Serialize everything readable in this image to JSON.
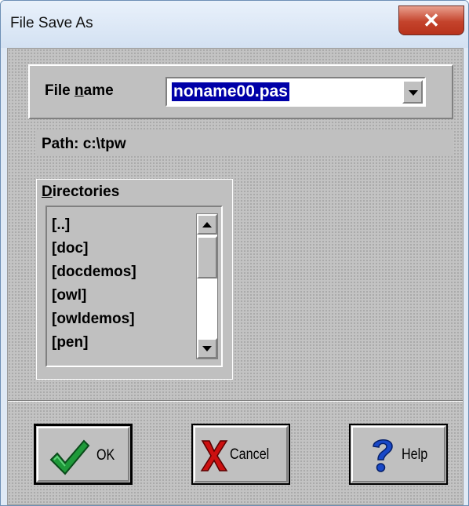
{
  "window": {
    "title": "File Save As",
    "close_glyph": "✕"
  },
  "file_name": {
    "label_pre": "File ",
    "label_key": "n",
    "label_post": "ame",
    "value": "noname00.pas"
  },
  "path": {
    "text": "Path: c:\\tpw"
  },
  "directories": {
    "label_key": "D",
    "label_rest": "irectories",
    "items": [
      "[..]",
      "[doc]",
      "[docdemos]",
      "[owl]",
      "[owldemos]",
      "[pen]"
    ]
  },
  "buttons": {
    "ok": {
      "label": "OK",
      "icon": "checkmark-icon"
    },
    "cancel": {
      "label": "Cancel",
      "icon": "x-icon"
    },
    "help": {
      "label": "Help",
      "icon": "question-mark-icon"
    }
  },
  "colors": {
    "selection": "#0000a8",
    "checkmark": "#1f9a3a",
    "cancel_x": "#cc1010",
    "help_q": "#1848c8"
  }
}
